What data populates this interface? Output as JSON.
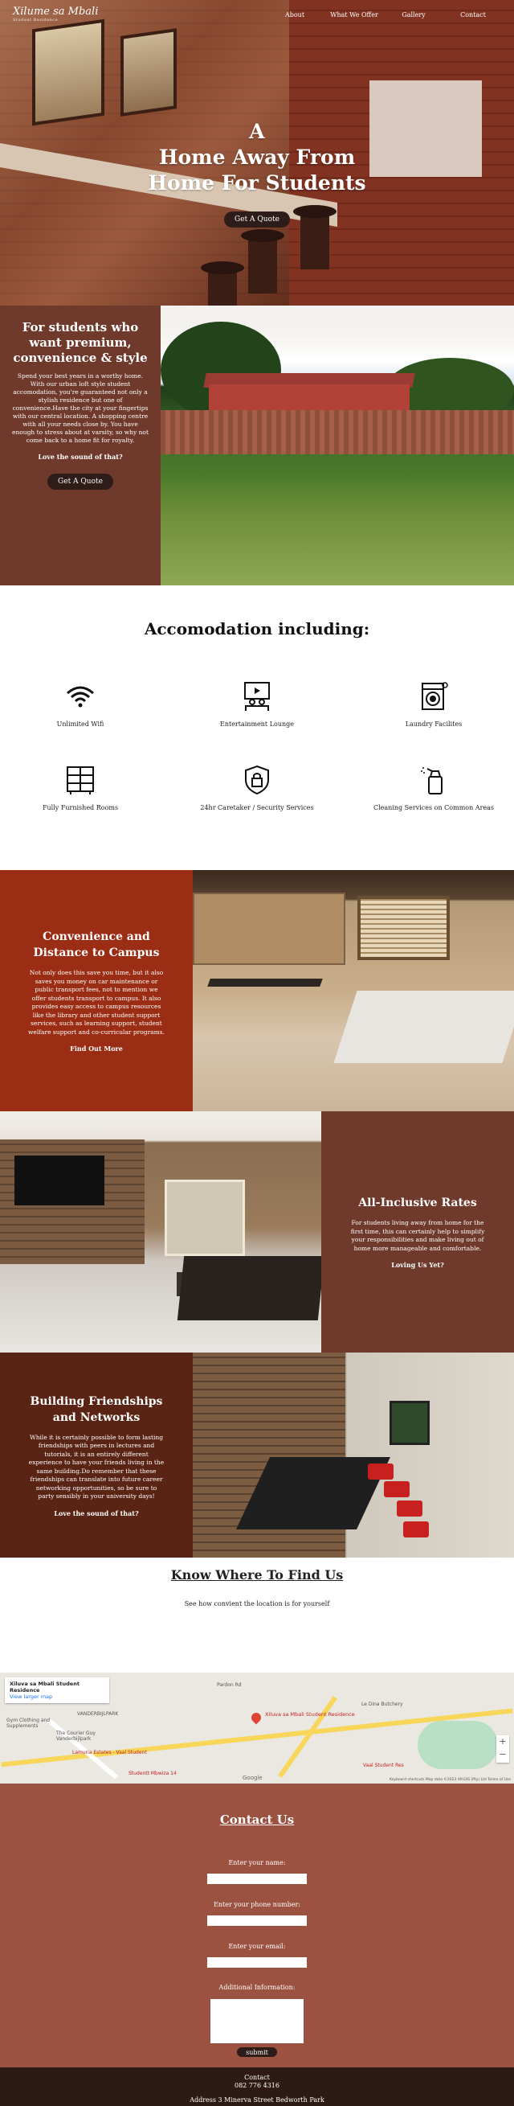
{
  "header": {
    "logo_text": "Xilume sa Mbali",
    "logo_sub": "Student Residence",
    "nav": [
      "About",
      "What We Offer",
      "Gallery",
      "Contact"
    ]
  },
  "hero": {
    "title_line1": "A",
    "title_line2": "Home Away From",
    "title_line3": "Home For Students",
    "button": "Get A Quote"
  },
  "premium": {
    "heading": "For students who want premium, convenience & style",
    "body": "Spend your best years in a worthy home. With our urban loft style student accomodation, you're guaranteed not only a stylish residence but one of convenience.Have the city at your fingertips with our central location. A shopping centre with all your needs close by. You have enough to stress about at varsity, so why not come back to a home fit for royalty.",
    "love": "Love the sound of that?",
    "button": "Get A Quote"
  },
  "accommodation": {
    "heading": "Accomodation including:",
    "features": [
      {
        "label": "Unlimited Wifi",
        "icon": "wifi-icon"
      },
      {
        "label": "Entertainment Lounge",
        "icon": "tv-lounge-icon"
      },
      {
        "label": "Laundry Facilites",
        "icon": "washing-machine-icon"
      },
      {
        "label": "Fully Furnished Rooms",
        "icon": "cabinet-icon"
      },
      {
        "label": "24hr Caretaker / Security Services",
        "icon": "security-shield-icon"
      },
      {
        "label": "Cleaning Services on Common Areas",
        "icon": "spray-bottle-icon"
      }
    ]
  },
  "convenience": {
    "heading": "Convenience and Distance to Campus",
    "body": "Not only does this save you time, but it also saves you money on car maintenance or public transport fees, not to mention we offer students transport to campus. It also provides easy access to campus resources like the library and other student support services, such as learning support, student welfare support and co-curricular programs.",
    "link": "Find Out More"
  },
  "rates": {
    "heading": "All-Inclusive Rates",
    "body": "For students living away from home for the first time, this can certainly help to simplify your responsibilities and make living out of home more manageable and comfortable.",
    "link": "Loving Us Yet?"
  },
  "friends": {
    "heading": "Building Friendships and Networks",
    "body": "While it is certainly possible to form lasting friendships with peers in lectures and tutorials, it is an entirely different experience to have your friends living in the same building.Do remember that these friendships can translate into future career networking opportunities, so be sure to party sensibly in your university days!",
    "link": "Love the sound of that?"
  },
  "findus": {
    "heading": "Know Where To Find Us",
    "subtitle": "See how convient the location is for yourself"
  },
  "map": {
    "card_title": "Xiluva sa Mbali Student Residence",
    "card_link": "View larger map",
    "pin_label": "Xiluva sa Mbali Student Residence",
    "labels": [
      "VANDERBIJLPARK",
      "Gym Clothing and Supplements",
      "The Courier Guy Vanderbijlpark",
      "Lamuria Estates - Vaal Student",
      "Studentt Mbwiza 14",
      "Vaal Student Res",
      "Le Dina Butchery",
      "Pardon Rd",
      "Google"
    ],
    "zoom_in": "+",
    "zoom_out": "−",
    "attribution": "Keyboard shortcuts   Map data ©2023 AfriGIS (Pty) Ltd   Terms of Use"
  },
  "contact": {
    "heading": "Contact Us",
    "name_label": "Enter your name:",
    "phone_label": "Enter your phone number:",
    "email_label": "Enter your email:",
    "info_label": "Additional Information:",
    "submit": "submit"
  },
  "footer": {
    "title": "Contact",
    "phone": "082 776 4316",
    "address": "Address 3 Minerva Street Bedworth Park"
  },
  "colors": {
    "hero_overlay": "#8a3a26",
    "premium_bg": "#6f3a2c",
    "convenience_bg": "#9a2d14",
    "friends_bg": "#5a2414",
    "contact_bg": "#9c5240",
    "footer_bg": "#2e1a14",
    "button_bg": "#2e1c18"
  }
}
